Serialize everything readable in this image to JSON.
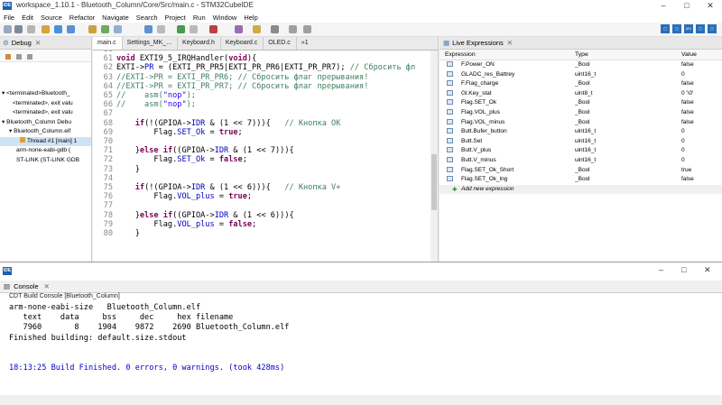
{
  "window": {
    "title": "workspace_1.10.1 - Bluetooth_Column/Core/Src/main.c - STM32CubeIDE",
    "icon": "IDE"
  },
  "menu": [
    "File",
    "Edit",
    "Source",
    "Refactor",
    "Navigate",
    "Search",
    "Project",
    "Run",
    "Window",
    "Help"
  ],
  "debug_view": {
    "title": "Debug",
    "items": [
      "<terminated>Bluetooth_",
      "<terminated>, exit valu",
      "<terminated>, exit valu",
      "Bluetooth_Column Debu",
      "Bluetooth_Column.elf",
      "Thread #1 [main] 1",
      "arm-none-eabi-gdb (",
      "ST-LINK (ST-LINK GDB"
    ]
  },
  "editor": {
    "tabs": [
      "main.c",
      "Settings_MK_...",
      "Keyboard.h",
      "Keyboard.c",
      "OLED.c",
      "»1"
    ],
    "active_tab": "main.c",
    "lines": [
      {
        "n": "60",
        "t": ""
      },
      {
        "n": "61",
        "t": "void EXTI9_5_IRQHandler(void){"
      },
      {
        "n": "62",
        "t": "EXTI->PR = (EXTI_PR_PR5|EXTI_PR_PR6|EXTI_PR_PR7); // Сбросить фл"
      },
      {
        "n": "63",
        "t": "//EXTI->PR = EXTI_PR_PR6; // Сбросить флаг прерывания!"
      },
      {
        "n": "64",
        "t": "//EXTI->PR = EXTI_PR_PR7; // Сбросить флаг прерывания!"
      },
      {
        "n": "65",
        "t": "//    asm(\"nop\");"
      },
      {
        "n": "66",
        "t": "//    asm(\"nop\");"
      },
      {
        "n": "67",
        "t": ""
      },
      {
        "n": "68",
        "t": "    if(!(GPIOA->IDR & (1 << 7))){   // Кнопка OK"
      },
      {
        "n": "69",
        "t": "        Flag.SET_Ok = true;"
      },
      {
        "n": "70",
        "t": ""
      },
      {
        "n": "71",
        "t": "    }else if((GPIOA->IDR & (1 << 7))){"
      },
      {
        "n": "72",
        "t": "        Flag.SET_Ok = false;"
      },
      {
        "n": "73",
        "t": "    }"
      },
      {
        "n": "74",
        "t": ""
      },
      {
        "n": "75",
        "t": "    if(!(GPIOA->IDR & (1 << 6))){   // Кнопка V+"
      },
      {
        "n": "76",
        "t": "        Flag.VOL_plus = true;"
      },
      {
        "n": "77",
        "t": ""
      },
      {
        "n": "78",
        "t": "    }else if((GPIOA->IDR & (1 << 6))){"
      },
      {
        "n": "79",
        "t": "        Flag.VOL_plus = false;"
      },
      {
        "n": "80",
        "t": "    }"
      }
    ]
  },
  "live_expressions": {
    "title": "Live Expressions",
    "columns": [
      "Expression",
      "Type",
      "Value"
    ],
    "rows": [
      [
        "F.Power_ON",
        "_Bool",
        "false"
      ],
      [
        "GLADC_res_Battrey",
        "uint16_t",
        "0"
      ],
      [
        "F.Flag_charge",
        "_Bool",
        "false"
      ],
      [
        "Gl.Key_stat",
        "uint8_t",
        "0 '\\0'"
      ],
      [
        "Flag.SET_Ok",
        "_Bool",
        "false"
      ],
      [
        "Flag.VOL_plus",
        "_Bool",
        "false"
      ],
      [
        "Flag.VOL_minus",
        "_Bool",
        "false"
      ],
      [
        "Butt.Bufer_button",
        "uint16_t",
        "0"
      ],
      [
        "Butt.Set",
        "uint16_t",
        "0"
      ],
      [
        "Butt.V_plus",
        "uint16_t",
        "0"
      ],
      [
        "Butt.V_minus",
        "uint16_t",
        "0"
      ],
      [
        "Flag.SET_Ok_Short",
        "_Bool",
        "true"
      ],
      [
        "Flag.SET_Ok_lng",
        "_Bool",
        "false"
      ]
    ],
    "add_label": "Add new expression"
  },
  "console": {
    "window_icon": "IDE",
    "title": "Console",
    "subtitle": "CDT Build Console [Bluetooth_Column]",
    "lines": [
      "arm-none-eabi-size   Bluetooth_Column.elf",
      "   text    data     bss     dec     hex filename",
      "   7960       8    1904    9872    2690 Bluetooth_Column.elf",
      "Finished building: default.size.stdout",
      "",
      "",
      "18:13:25 Build Finished. 0 errors, 0 warnings. (took 428ms)"
    ]
  },
  "colors": {
    "keyword": "#7f0055",
    "comment": "#3f7f5f",
    "string": "#2a00ff",
    "field": "#0000c0",
    "status_blue": "#0000c8"
  }
}
